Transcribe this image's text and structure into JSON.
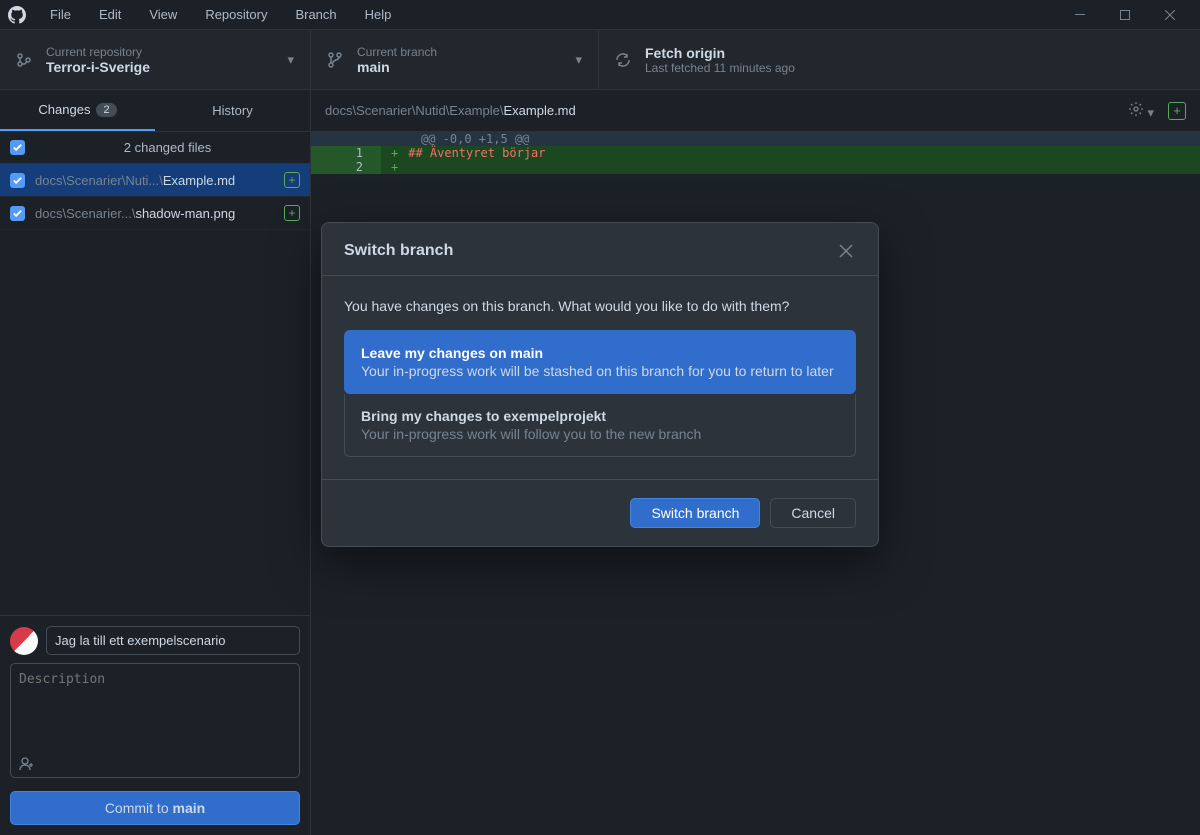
{
  "menu": [
    "File",
    "Edit",
    "View",
    "Repository",
    "Branch",
    "Help"
  ],
  "toolbar": {
    "repo_label": "Current repository",
    "repo_value": "Terror-i-Sverige",
    "branch_label": "Current branch",
    "branch_value": "main",
    "fetch_label": "Fetch origin",
    "fetch_value": "Last fetched 11 minutes ago"
  },
  "tabs": {
    "changes": "Changes",
    "changes_count": "2",
    "history": "History"
  },
  "files": {
    "summary": "2 changed files",
    "items": [
      {
        "dim": "docs\\Scenarier\\Nuti...\\",
        "bright": "Example.md"
      },
      {
        "dim": "docs\\Scenarier...\\",
        "bright": "shadow-man.png"
      }
    ]
  },
  "commit": {
    "summary": "Jag la till ett exempelscenario",
    "desc_placeholder": "Description",
    "button_prefix": "Commit to ",
    "button_branch": "main"
  },
  "breadcrumb": {
    "dim": "docs\\Scenarier\\Nutid\\Example\\",
    "bright": "Example.md"
  },
  "diff": {
    "hunk": "@@ -0,0 +1,5 @@",
    "lines": [
      {
        "num": "1",
        "text": "## Äventyret börjar",
        "md": true
      },
      {
        "num": "2",
        "text": "",
        "md": false
      }
    ]
  },
  "modal": {
    "title": "Switch branch",
    "question": "You have changes on this branch. What would you like to do with them?",
    "opt1_title": "Leave my changes on main",
    "opt1_desc": "Your in-progress work will be stashed on this branch for you to return to later",
    "opt2_title": "Bring my changes to exempelprojekt",
    "opt2_desc": "Your in-progress work will follow you to the new branch",
    "confirm": "Switch branch",
    "cancel": "Cancel"
  }
}
